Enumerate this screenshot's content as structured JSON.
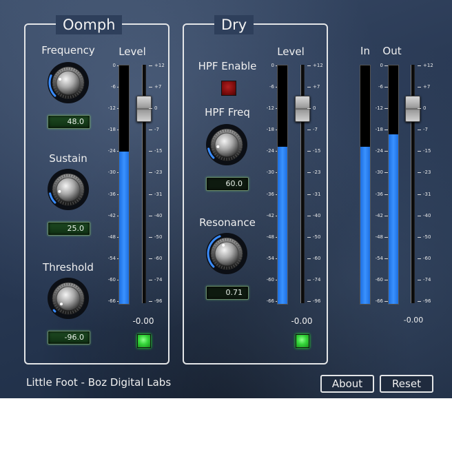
{
  "oomph": {
    "title": "Oomph",
    "frequency": {
      "label": "Frequency",
      "value": "48.0",
      "knob_level": 0.25
    },
    "sustain": {
      "label": "Sustain",
      "value": "25.0",
      "knob_level": 0.12
    },
    "threshold": {
      "label": "Threshold",
      "value": "-96.0",
      "knob_level": 0.02
    },
    "level_label": "Level",
    "level_readout": "-0.00",
    "meter_fill": 0.64,
    "fader_position": "0",
    "enable_state": "on"
  },
  "dry": {
    "title": "Dry",
    "hpf_enable_label": "HPF Enable",
    "hpf_enable_state": "off",
    "hpf_freq": {
      "label": "HPF Freq",
      "value": "60.0",
      "knob_level": 0.12
    },
    "resonance": {
      "label": "Resonance",
      "value": "0.71",
      "knob_level": 0.42
    },
    "level_label": "Level",
    "level_readout": "-0.00",
    "meter_fill": 0.66,
    "fader_position": "0",
    "enable_state": "on"
  },
  "master": {
    "in_label": "In",
    "out_label": "Out",
    "in_meter_fill": 0.66,
    "out_meter_fill": 0.71,
    "readout": "-0.00",
    "fader_position": "0"
  },
  "meter_scale": [
    "0",
    "-6",
    "-12",
    "-18",
    "-24",
    "-30",
    "-36",
    "-42",
    "-48",
    "-54",
    "-60",
    "-66"
  ],
  "fader_scale": [
    "+12",
    "+7",
    "0",
    "-7",
    "-15",
    "-23",
    "-31",
    "-40",
    "-50",
    "-60",
    "-74",
    "-96"
  ],
  "footer": {
    "brand": "Little Foot - Boz Digital Labs"
  },
  "buttons": {
    "about": "About",
    "reset": "Reset"
  },
  "colors": {
    "meter_blue": "#2a86f5",
    "led_green": "#35d63a",
    "led_red": "#7a0b0b",
    "lcd_green": "#1e4a22"
  }
}
